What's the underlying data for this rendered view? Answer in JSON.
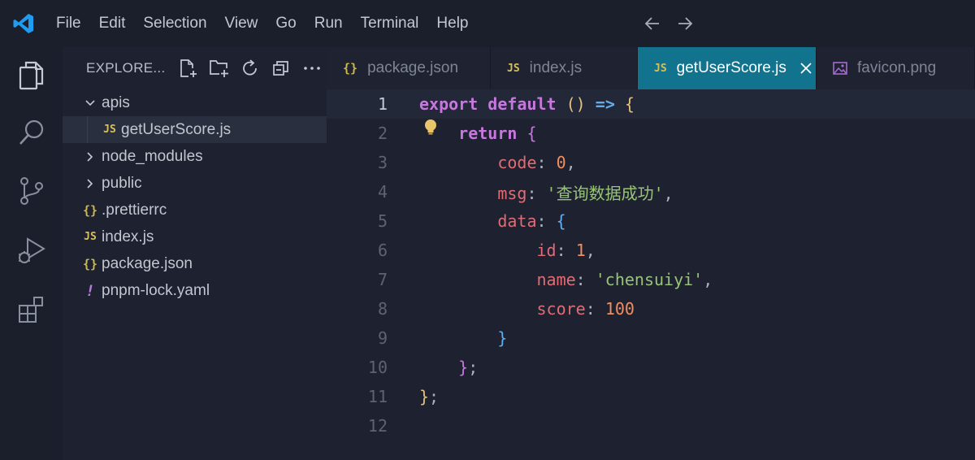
{
  "menu": [
    "File",
    "Edit",
    "Selection",
    "View",
    "Go",
    "Run",
    "Terminal",
    "Help"
  ],
  "explorer": {
    "title": "EXPLORE...",
    "tree": [
      {
        "label": "apis",
        "type": "folder",
        "expanded": true
      },
      {
        "label": "getUserScore.js",
        "type": "js",
        "selected": true
      },
      {
        "label": "node_modules",
        "type": "folder",
        "expanded": false
      },
      {
        "label": "public",
        "type": "folder",
        "expanded": false
      },
      {
        "label": ".prettierrc",
        "type": "json"
      },
      {
        "label": "index.js",
        "type": "js"
      },
      {
        "label": "package.json",
        "type": "json"
      },
      {
        "label": "pnpm-lock.yaml",
        "type": "yaml"
      }
    ]
  },
  "icon_glyphs": {
    "js": "JS",
    "json": "{}",
    "yaml": "!"
  },
  "tabs": [
    {
      "label": "package.json",
      "type": "json",
      "active": false
    },
    {
      "label": "index.js",
      "type": "js",
      "active": false
    },
    {
      "label": "getUserScore.js",
      "type": "js",
      "active": true
    },
    {
      "label": "favicon.png",
      "type": "image",
      "active": false
    }
  ],
  "editor": {
    "current_line": 1,
    "lines": [
      [
        [
          "kw",
          "export"
        ],
        [
          "pun",
          " "
        ],
        [
          "kw",
          "default"
        ],
        [
          "pun",
          " "
        ],
        [
          "par",
          "()"
        ],
        [
          "pun",
          " "
        ],
        [
          "arrow",
          "=>"
        ],
        [
          "pun",
          " "
        ],
        [
          "br1",
          "{"
        ]
      ],
      [
        [
          "pun",
          "    "
        ],
        [
          "kw2",
          "return"
        ],
        [
          "pun",
          " "
        ],
        [
          "br2",
          "{"
        ]
      ],
      [
        [
          "pun",
          "        "
        ],
        [
          "prop",
          "code"
        ],
        [
          "pun",
          ": "
        ],
        [
          "num",
          "0"
        ],
        [
          "pun",
          ","
        ]
      ],
      [
        [
          "pun",
          "        "
        ],
        [
          "prop",
          "msg"
        ],
        [
          "pun",
          ": "
        ],
        [
          "str",
          "'查询数据成功'"
        ],
        [
          "pun",
          ","
        ]
      ],
      [
        [
          "pun",
          "        "
        ],
        [
          "prop",
          "data"
        ],
        [
          "pun",
          ": "
        ],
        [
          "br3",
          "{"
        ]
      ],
      [
        [
          "pun",
          "            "
        ],
        [
          "prop",
          "id"
        ],
        [
          "pun",
          ": "
        ],
        [
          "num",
          "1"
        ],
        [
          "pun",
          ","
        ]
      ],
      [
        [
          "pun",
          "            "
        ],
        [
          "prop",
          "name"
        ],
        [
          "pun",
          ": "
        ],
        [
          "str",
          "'chensuiyi'"
        ],
        [
          "pun",
          ","
        ]
      ],
      [
        [
          "pun",
          "            "
        ],
        [
          "prop",
          "score"
        ],
        [
          "pun",
          ": "
        ],
        [
          "num",
          "100"
        ]
      ],
      [
        [
          "pun",
          "        "
        ],
        [
          "br3",
          "}"
        ]
      ],
      [
        [
          "pun",
          "    "
        ],
        [
          "br2",
          "}"
        ],
        [
          "pun",
          ";"
        ]
      ],
      [
        [
          "br1",
          "}"
        ],
        [
          "pun",
          ";"
        ]
      ],
      []
    ]
  },
  "colors": {
    "accent_tab": "#11738d",
    "background": "#1e2230",
    "js_icon": "#d7c05a",
    "json_icon": "#cbb94e",
    "yaml_icon": "#b77ad8",
    "vscode_logo": "#1f9cf0"
  }
}
